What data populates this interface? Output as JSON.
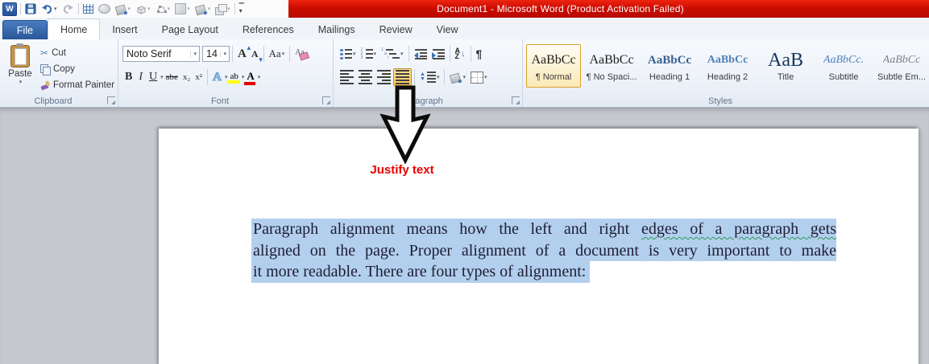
{
  "colors": {
    "selection": "#b3cfee",
    "caption": "#e60000",
    "heading1": "#365f91",
    "heading2": "#4f81bd",
    "title_style": "#17365d",
    "subtitle": "#4f81bd",
    "subtle": "#7d828c"
  },
  "title_bar": {
    "title": "Document1  -  Microsoft Word (Product Activation Failed)"
  },
  "quick_access": {
    "icons": [
      "word-logo",
      "save",
      "undo",
      "redo",
      "view-gridlines",
      "oval-shape",
      "shape-fill",
      "3d-effects",
      "edit-shape",
      "shadow-style",
      "fill-color",
      "arrange-layers",
      "customize-quick-access-toolbar"
    ]
  },
  "tabs": {
    "file": "File",
    "items": [
      {
        "label": "Home",
        "active": true
      },
      {
        "label": "Insert"
      },
      {
        "label": "Page Layout"
      },
      {
        "label": "References"
      },
      {
        "label": "Mailings"
      },
      {
        "label": "Review"
      },
      {
        "label": "View"
      }
    ]
  },
  "ribbon": {
    "clipboard": {
      "group_label": "Clipboard",
      "paste_label": "Paste",
      "cut_label": "Cut",
      "copy_label": "Copy",
      "format_painter_label": "Format Painter"
    },
    "font": {
      "group_label": "Font",
      "name": "Noto Serif",
      "size": "14",
      "grow_label": "A",
      "shrink_label": "A",
      "case_label": "Aa",
      "bold_label": "B",
      "italic_label": "I",
      "underline_label": "U",
      "strike_label": "abe",
      "sub_label": "x₂",
      "sup_label": "x²",
      "effects_label": "A",
      "highlight_label": "ab",
      "color_label": "A"
    },
    "paragraph": {
      "group_label": "Paragraph",
      "sort_a": "A",
      "sort_z": "Z",
      "pilcrow": "¶"
    },
    "styles": {
      "group_label": "Styles",
      "items": [
        {
          "preview": "AaBbCc",
          "label": "¶ Normal",
          "selected": true
        },
        {
          "preview": "AaBbCc",
          "label": "¶ No Spaci..."
        },
        {
          "preview": "AaBbCc",
          "label": "Heading 1"
        },
        {
          "preview": "AaBbCc",
          "label": "Heading 2"
        },
        {
          "preview": "AaB",
          "label": "Title"
        },
        {
          "preview": "AaBbCc.",
          "label": "Subtitle"
        },
        {
          "preview": "AaBbCc",
          "label": "Subtle Em..."
        }
      ]
    }
  },
  "annotation": {
    "caption": "Justify text"
  },
  "document": {
    "line1_pre": "Paragraph alignment means how the left and right ",
    "line1_squiggle": "edges of a paragraph gets",
    "line2": "aligned on the page. Proper alignment of a document is very important to make",
    "line3": "it more readable. There are four types of alignment:"
  }
}
